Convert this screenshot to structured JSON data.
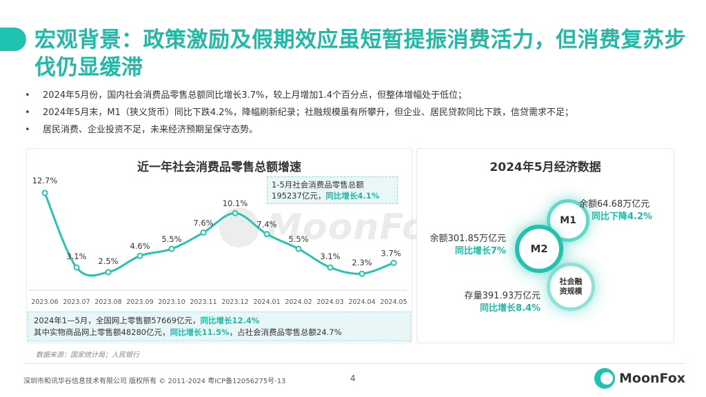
{
  "header": {
    "title": "宏观背景：政策激励及假期效应虽短暂提振消费活力，但消费复苏步伐仍显缓滞"
  },
  "bullets": [
    "2024年5月份，国内社会消费品零售总额同比增长3.7%，较上月增加1.4个百分点，但整体增幅处于低位；",
    "2024年5月末，M1（狭义货币）同比下跌4.2%，降幅刷新纪录；社融规模虽有所攀升，但企业、居民贷款同比下跌，信贷需求不足；",
    "居民消费、企业投资不足，未来经济预期呈保守态势。"
  ],
  "left_panel": {
    "callout_line1": "1-5月社会消费品零售总额",
    "callout_line2_prefix": "195237亿元，",
    "callout_line2_highlight": "同比增长4.1%",
    "summary_line1_prefix": "2024年1—5月，全国网上零售额57669亿元，",
    "summary_line1_highlight": "同比增长12.4%",
    "summary_line2_prefix": "其中实物商品网上零售额48280亿元，",
    "summary_line2_highlight": "同比增长11.5%",
    "summary_line2_suffix": "，占社会消费品零售总额24.7%"
  },
  "chart_data": {
    "type": "line",
    "title": "近一年社会消费品零售总额增速",
    "categories": [
      "2023.06",
      "2023.07",
      "2023.08",
      "2023.09",
      "2023.10",
      "2023.11",
      "2023.12",
      "2024.01",
      "2024.02",
      "2024.03",
      "2024.04",
      "2024.05"
    ],
    "values": [
      12.7,
      3.1,
      2.5,
      4.6,
      5.5,
      7.6,
      10.1,
      7.4,
      5.5,
      3.1,
      2.3,
      3.7
    ],
    "labels": [
      "12.7%",
      "3.1%",
      "2.5%",
      "4.6%",
      "5.5%",
      "7.6%",
      "10.1%",
      "7.4%",
      "5.5%",
      "3.1%",
      "2.3%",
      "3.7%"
    ],
    "ylim": [
      0,
      14
    ],
    "grid": false,
    "line_color": "#26c4b0"
  },
  "right_panel": {
    "title": "2024年5月经济数据",
    "m1_label": "M1",
    "m2_label": "M2",
    "social_label_line1": "社会融",
    "social_label_line2": "资规模",
    "m1_value": "余额64.68万亿元",
    "m1_change": "同比下降4.2%",
    "m2_value": "余额301.85万亿元",
    "m2_change": "同比增长7%",
    "social_value": "存量391.93万亿元",
    "social_change": "同比增长8.4%"
  },
  "footer": {
    "source": "数据来源：国家统计局；人民银行",
    "copyright": "深圳市和讯华谷信息技术有限公司 版权所有 © 2011-2024 粤ICP备12056275号-13",
    "page_number": "4",
    "brand": "MoonFox",
    "watermark": "MoonFox"
  },
  "colors": {
    "accent": "#1fbaa6",
    "text": "#333333"
  }
}
